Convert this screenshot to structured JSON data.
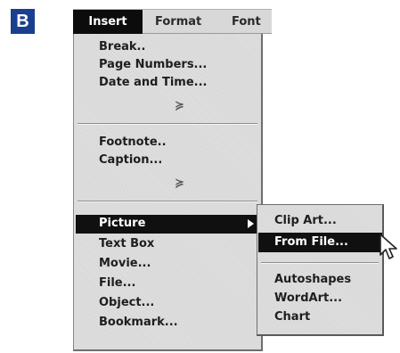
{
  "badge": "B",
  "menubar": {
    "insert": "Insert",
    "format": "Format",
    "font": "Font"
  },
  "insert_menu": {
    "group1": [
      "Break..",
      "Page Numbers...",
      "Date and Time..."
    ],
    "group1_more": "≽",
    "group2": [
      "Footnote..",
      "Caption..."
    ],
    "group2_more": "≽",
    "highlighted": "Picture",
    "group3": [
      "Text Box",
      "Movie...",
      "File...",
      "Object...",
      "Bookmark..."
    ]
  },
  "picture_submenu": {
    "items_top": [
      "Clip Art...",
      "From File..."
    ],
    "highlighted_index": 1,
    "items_bottom": [
      "Autoshapes",
      "WordArt...",
      "Chart"
    ]
  },
  "icons": {
    "submenu_arrow": "triangle-right-icon",
    "more": "double-chevron-down-icon",
    "cursor": "mouse-pointer-icon"
  },
  "colors": {
    "badge": "#1a3f8e",
    "highlight": "#101010",
    "menu_bg": "#dedede"
  }
}
